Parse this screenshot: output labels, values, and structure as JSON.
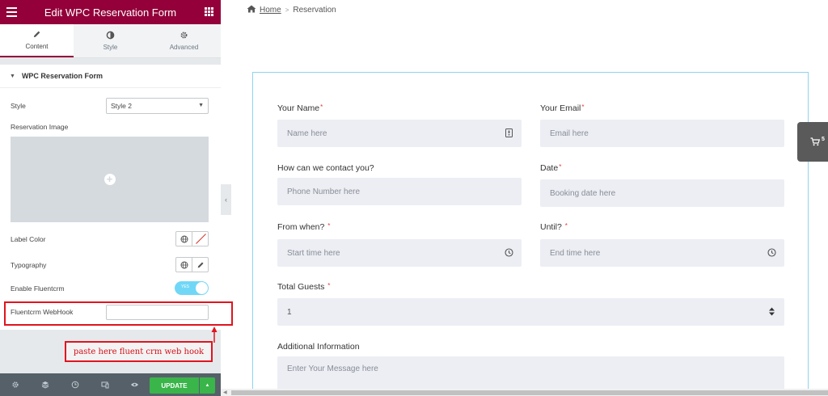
{
  "panel": {
    "title": "Edit WPC Reservation Form",
    "tabs": [
      {
        "label": "Content",
        "icon": "pencil-icon",
        "active": true
      },
      {
        "label": "Style",
        "icon": "half-circle-icon",
        "active": false
      },
      {
        "label": "Advanced",
        "icon": "gear-icon",
        "active": false
      }
    ],
    "section_title": "WPC Reservation Form",
    "controls": {
      "style_label": "Style",
      "style_value": "Style 2",
      "image_label": "Reservation Image",
      "label_color_label": "Label Color",
      "typography_label": "Typography",
      "fluentcrm_label": "Enable Fluentcrm",
      "fluentcrm_toggle": "YES",
      "webhook_label": "Fluentcrm WebHook",
      "webhook_value": ""
    },
    "annotation": "paste here fluent crm web hook",
    "footer": {
      "update_label": "UPDATE",
      "icons": [
        "settings-icon",
        "layers-icon",
        "history-icon",
        "responsive-icon",
        "preview-icon"
      ]
    }
  },
  "breadcrumb": {
    "home": "Home",
    "current": "Reservation"
  },
  "form": {
    "name_label": "Your Name",
    "name_placeholder": "Name here",
    "email_label": "Your Email",
    "email_placeholder": "Email here",
    "contact_label": "How can we contact you?",
    "contact_placeholder": "Phone Number here",
    "date_label": "Date",
    "date_placeholder": "Booking date here",
    "from_label": "From when?",
    "from_placeholder": "Start time here",
    "until_label": "Until?",
    "until_placeholder": "End time here",
    "guests_label": "Total Guests",
    "guests_value": "1",
    "info_label": "Additional Information",
    "info_placeholder": "Enter Your Message here",
    "required_mark": "*"
  },
  "cart": {
    "count": "5"
  },
  "colors": {
    "panel_header": "#93003a",
    "update_button": "#39b54a",
    "toggle_on": "#71d7f7",
    "annotation_red": "#e0141e",
    "field_bg": "#eceef4"
  }
}
